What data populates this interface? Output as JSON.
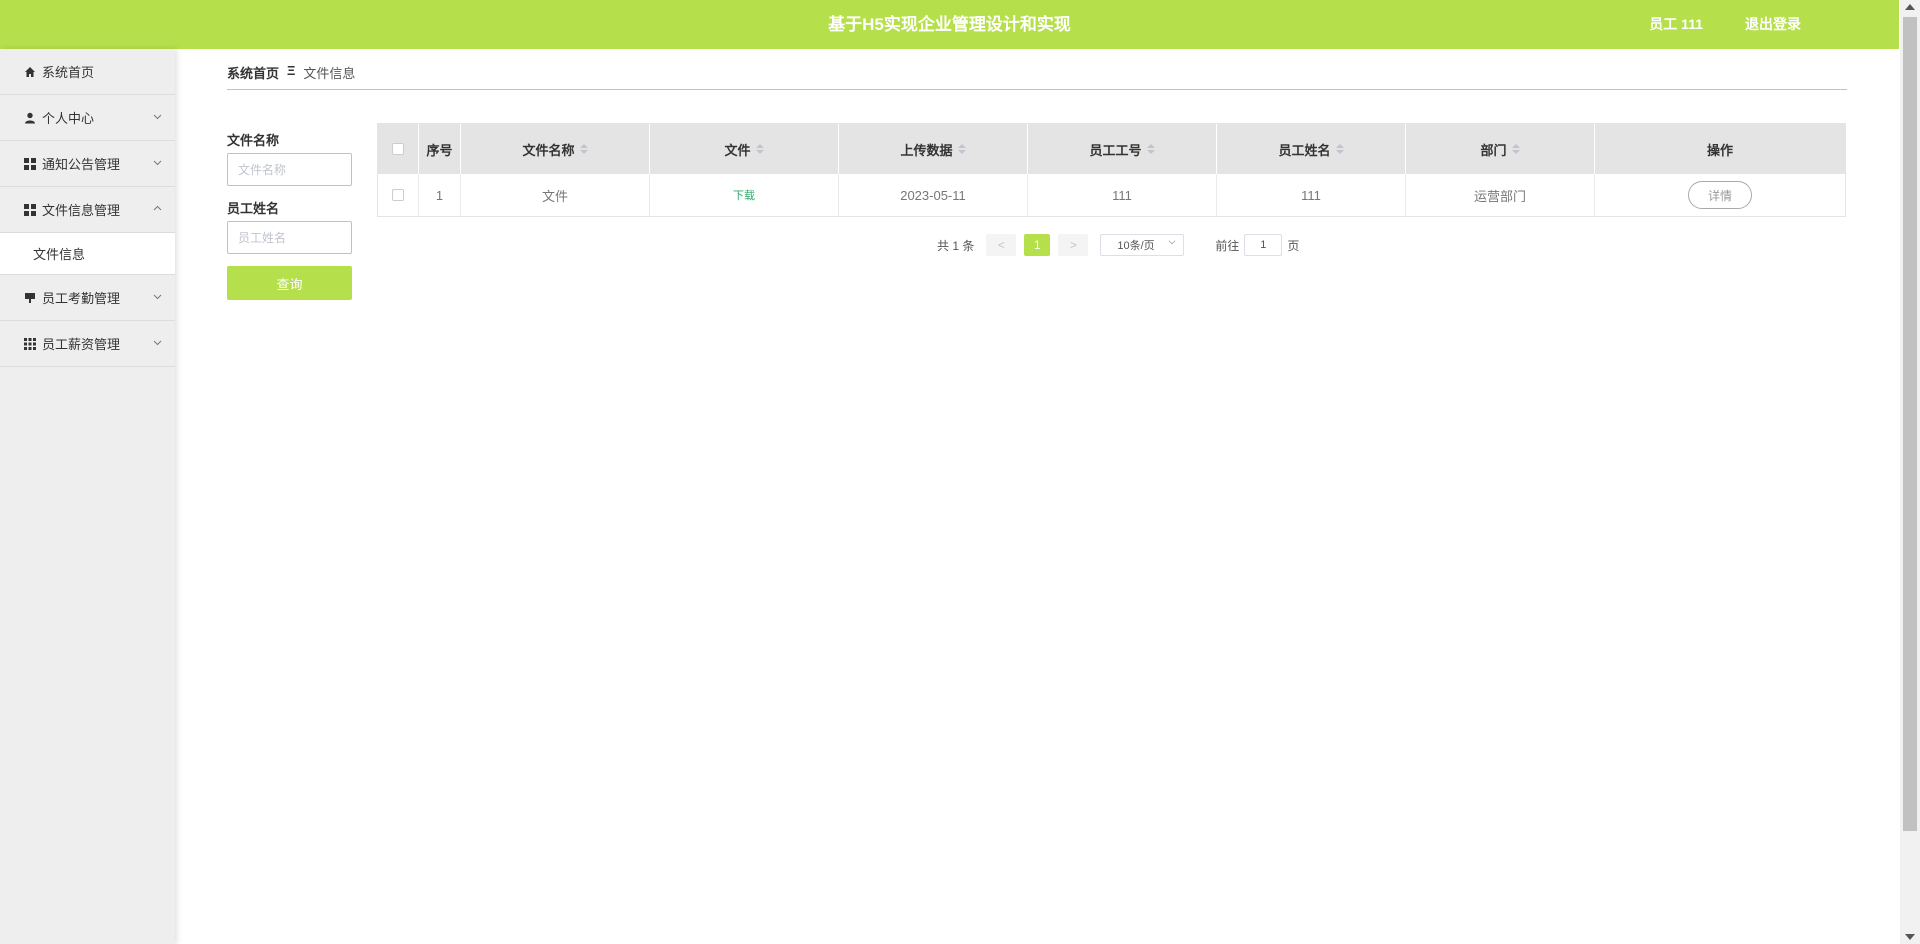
{
  "header": {
    "title": "基于H5实现企业管理设计和实现",
    "user": "员工 111",
    "logout": "退出登录"
  },
  "sidebar": {
    "items": [
      {
        "label": "系统首页",
        "icon": "home-icon"
      },
      {
        "label": "个人中心",
        "icon": "user-icon"
      },
      {
        "label": "通知公告管理",
        "icon": "grid-icon"
      },
      {
        "label": "文件信息管理",
        "icon": "grid-icon",
        "expanded": true
      },
      {
        "label": "员工考勤管理",
        "icon": "stamp-icon"
      },
      {
        "label": "员工薪资管理",
        "icon": "apps-icon"
      }
    ],
    "sub_item": "文件信息"
  },
  "breadcrumb": {
    "home": "系统首页",
    "separator": "Ξ",
    "current": "文件信息"
  },
  "search": {
    "file_name_label": "文件名称",
    "file_name_placeholder": "文件名称",
    "employee_name_label": "员工姓名",
    "employee_name_placeholder": "员工姓名",
    "query_button": "查询"
  },
  "table": {
    "columns": [
      "序号",
      "文件名称",
      "文件",
      "上传数据",
      "员工工号",
      "员工姓名",
      "部门",
      "操作"
    ],
    "rows": [
      {
        "index": "1",
        "file_name": "文件",
        "file": "下载",
        "upload_date": "2023-05-11",
        "employee_no": "111",
        "employee_name": "111",
        "department": "运营部门",
        "action": "详情"
      }
    ]
  },
  "pagination": {
    "total": "共 1 条",
    "prev": "<",
    "current_page": "1",
    "next": ">",
    "page_size": "10条/页",
    "goto_label": "前往",
    "goto_value": "1",
    "page_suffix": "页"
  },
  "colors": {
    "accent": "#b5df4b",
    "download_link": "#2eaa6c",
    "sidebar_bg": "#eeeeee",
    "table_header_bg": "#e4e4e4"
  }
}
